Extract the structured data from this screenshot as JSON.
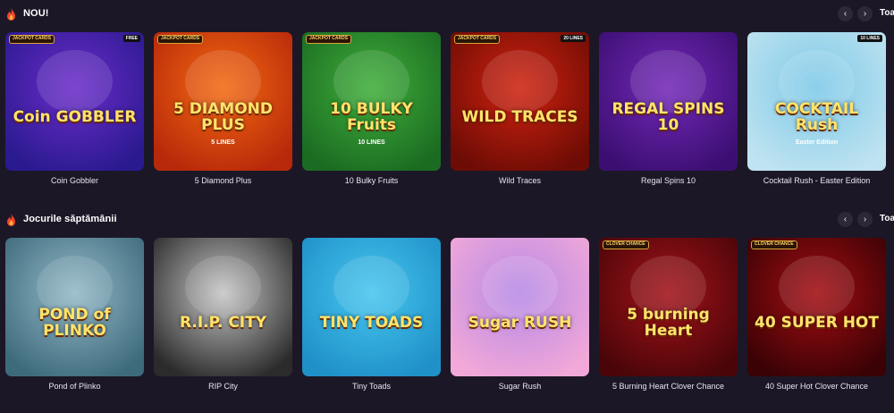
{
  "sections": [
    {
      "title": "NOU!",
      "see_all": "Toa",
      "games": [
        {
          "name": "Coin Gobbler",
          "art_title": "Coin GOBBLER",
          "badge": "JACKPOT CARDS",
          "badge2": "FREE",
          "colors": [
            "#6b2cc9",
            "#2a1a8f"
          ]
        },
        {
          "name": "5 Diamond Plus",
          "art_title": "5 DIAMOND PLUS",
          "sub": "5 LINES",
          "badge": "JACKPOT CARDS",
          "colors": [
            "#f26a12",
            "#b8280a"
          ]
        },
        {
          "name": "10 Bulky Fruits",
          "art_title": "10 BULKY Fruits",
          "sub": "10 LINES",
          "badge": "JACKPOT CARDS",
          "colors": [
            "#3fae3a",
            "#1b6b22"
          ]
        },
        {
          "name": "Wild Traces",
          "art_title": "WILD TRACES",
          "badge": "JACKPOT CARDS",
          "badge2": "20 LINES",
          "colors": [
            "#d0220f",
            "#6d0c05"
          ]
        },
        {
          "name": "Regal Spins 10",
          "art_title": "REGAL SPINS 10",
          "colors": [
            "#7428b8",
            "#3b0f72"
          ]
        },
        {
          "name": "Cocktail Rush - Easter Edition",
          "art_title": "COCKTAIL Rush",
          "sub": "Easter Edition",
          "badge2": "10 LINES",
          "colors": [
            "#7ec9e8",
            "#bfe3f0"
          ]
        }
      ]
    },
    {
      "title": "Jocurile săptămânii",
      "see_all": "Toa",
      "games": [
        {
          "name": "Pond of Plinko",
          "art_title": "POND of PLINKO",
          "colors": [
            "#93b8c7",
            "#3e6b7c"
          ]
        },
        {
          "name": "RIP City",
          "art_title": "R.I.P. CITY",
          "colors": [
            "#c7c7c7",
            "#2b2b2b"
          ]
        },
        {
          "name": "Tiny Toads",
          "art_title": "TINY TOADS",
          "colors": [
            "#46c6ef",
            "#1f90c8"
          ]
        },
        {
          "name": "Sugar Rush",
          "art_title": "Sugar RUSH",
          "colors": [
            "#b58ae6",
            "#f2a8d8"
          ]
        },
        {
          "name": "5 Burning Heart Clover Chance",
          "art_title": "5 burning Heart",
          "badge": "CLOVER CHANCE",
          "colors": [
            "#a2131a",
            "#4a0508"
          ]
        },
        {
          "name": "40 Super Hot Clover Chance",
          "art_title": "40 SUPER HOT",
          "badge": "CLOVER CHANCE",
          "colors": [
            "#a30d12",
            "#3a0205"
          ]
        }
      ]
    }
  ],
  "nav": {
    "prev": "‹",
    "next": "›"
  }
}
